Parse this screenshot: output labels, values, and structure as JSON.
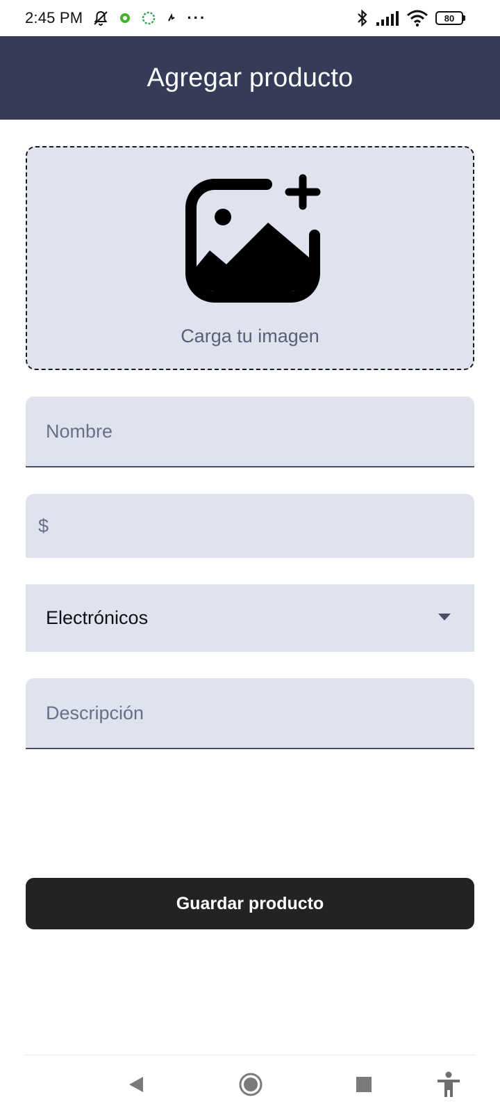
{
  "status_bar": {
    "time": "2:45 PM",
    "overflow": "···",
    "battery": "80",
    "icons": [
      "bell-off-icon",
      "app-notification-icon",
      "sync-ring-icon",
      "small-app-icon",
      "bluetooth-icon",
      "signal-icon",
      "wifi-icon",
      "battery-icon"
    ]
  },
  "app_bar": {
    "title": "Agregar producto"
  },
  "upload": {
    "label": "Carga tu imagen",
    "icon": "add-photo-icon"
  },
  "form": {
    "name_placeholder": "Nombre",
    "name_value": "",
    "price_symbol": "$",
    "price_value": "",
    "category_selected": "Electrónicos",
    "description_placeholder": "Descripción",
    "description_value": ""
  },
  "actions": {
    "save_label": "Guardar producto"
  },
  "nav": {
    "icons": [
      "back-icon",
      "home-icon",
      "recent-apps-icon",
      "accessibility-icon"
    ]
  },
  "colors": {
    "app_bar": "#363c58",
    "field_bg": "#dfe3f0",
    "button_bg": "#232323"
  }
}
